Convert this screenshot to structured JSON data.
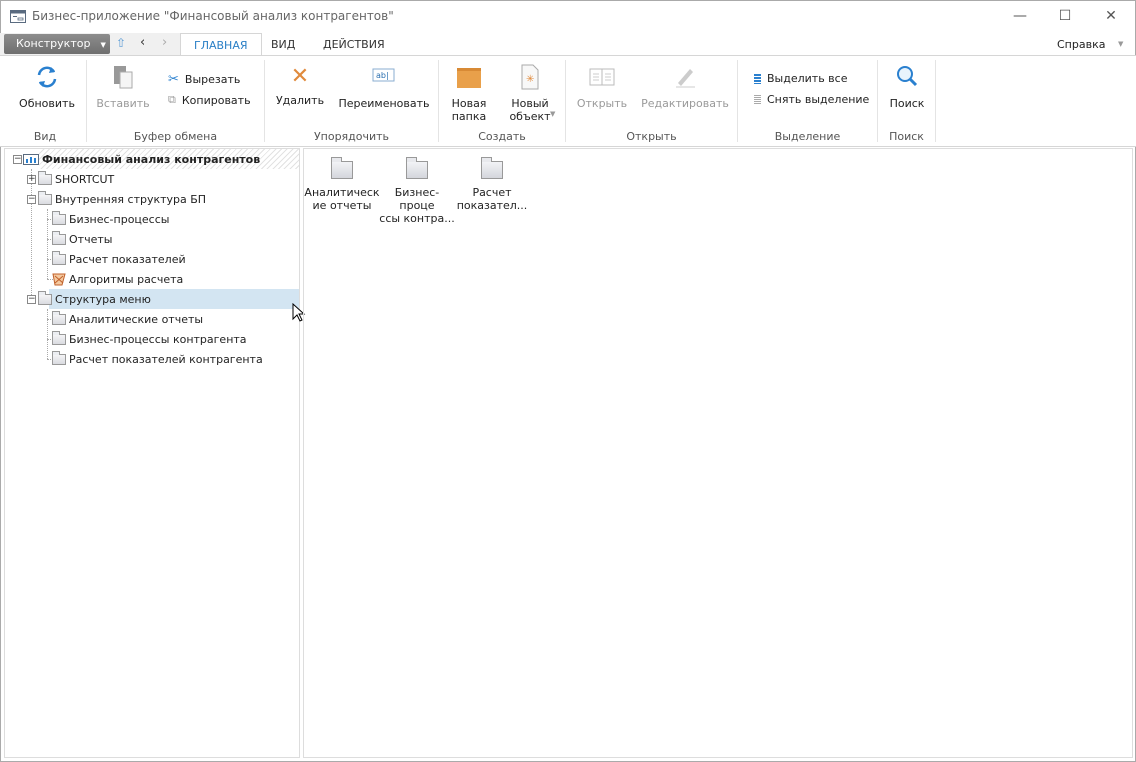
{
  "window": {
    "title": "Бизнес-приложение \"Финансовый анализ контрагентов\"",
    "minimize": "—",
    "maximize": "☐",
    "close": "✕"
  },
  "menubar": {
    "konstruktor": "Конструктор",
    "tabs": [
      "ГЛАВНАЯ",
      "ВИД",
      "ДЕЙСТВИЯ"
    ],
    "help": "Справка"
  },
  "ribbon": {
    "refresh": "Обновить",
    "paste": "Вставить",
    "cut": "Вырезать",
    "copy": "Копировать",
    "delete": "Удалить",
    "rename": "Переименовать",
    "new_folder": [
      "Новая",
      "папка"
    ],
    "new_object": [
      "Новый",
      "объект"
    ],
    "open": "Открыть",
    "edit": "Редактировать",
    "select_all": "Выделить все",
    "deselect": "Снять выделение",
    "search": "Поиск",
    "groups": [
      "Вид",
      "Буфер обмена",
      "Упорядочить",
      "Создать",
      "Открыть",
      "Выделение",
      "Поиск"
    ]
  },
  "tree": {
    "root": "Финансовый анализ контрагентов",
    "items": [
      "SHORTCUT",
      "Внутренняя структура БП",
      "Бизнес-процессы",
      "Отчеты",
      "Расчет показателей",
      "Алгоритмы расчета",
      "Структура меню",
      "Аналитические отчеты",
      "Бизнес-процессы контрагента",
      "Расчет показателей контрагента"
    ]
  },
  "content": {
    "items": [
      [
        "Аналитическ",
        "ие отчеты"
      ],
      [
        "Бизнес-проце",
        "ссы контра..."
      ],
      [
        "Расчет",
        "показател..."
      ]
    ]
  }
}
